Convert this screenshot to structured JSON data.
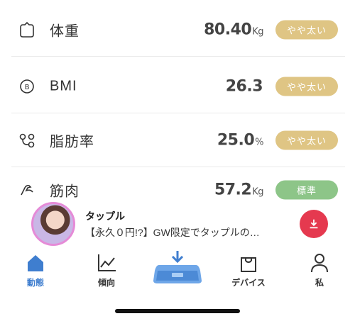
{
  "metrics": [
    {
      "id": "weight",
      "label": "体重",
      "value": "80.40",
      "unit": "Kg",
      "badge": "やや太い",
      "badge_color": "#dfc584",
      "icon": "weight-icon"
    },
    {
      "id": "bmi",
      "label": "BMI",
      "value": "26.3",
      "unit": "",
      "badge": "やや太い",
      "badge_color": "#dfc584",
      "icon": "bmi-icon"
    },
    {
      "id": "body-fat",
      "label": "脂肪率",
      "value": "25.0",
      "unit": "%",
      "badge": "やや太い",
      "badge_color": "#dfc584",
      "icon": "body-fat-icon"
    },
    {
      "id": "muscle",
      "label": "筋肉",
      "value": "57.2",
      "unit": "Kg",
      "badge": "標準",
      "badge_color": "#8dc588",
      "icon": "muscle-icon"
    }
  ],
  "ad": {
    "title": "タップル",
    "text": "【永久０円!?】GW限定でタップルの…",
    "download_color": "#e5394f"
  },
  "tabs": [
    {
      "id": "activity",
      "label": "動態",
      "active": true,
      "icon": "home-icon"
    },
    {
      "id": "trend",
      "label": "傾向",
      "active": false,
      "icon": "trend-chart-icon"
    },
    {
      "id": "devices",
      "label": "デバイス",
      "active": false,
      "icon": "device-bag-icon"
    },
    {
      "id": "me",
      "label": "私",
      "active": false,
      "icon": "person-icon"
    }
  ],
  "colors": {
    "accent": "#3f7ecf",
    "caution": "#dfc584",
    "normal": "#8dc588"
  }
}
